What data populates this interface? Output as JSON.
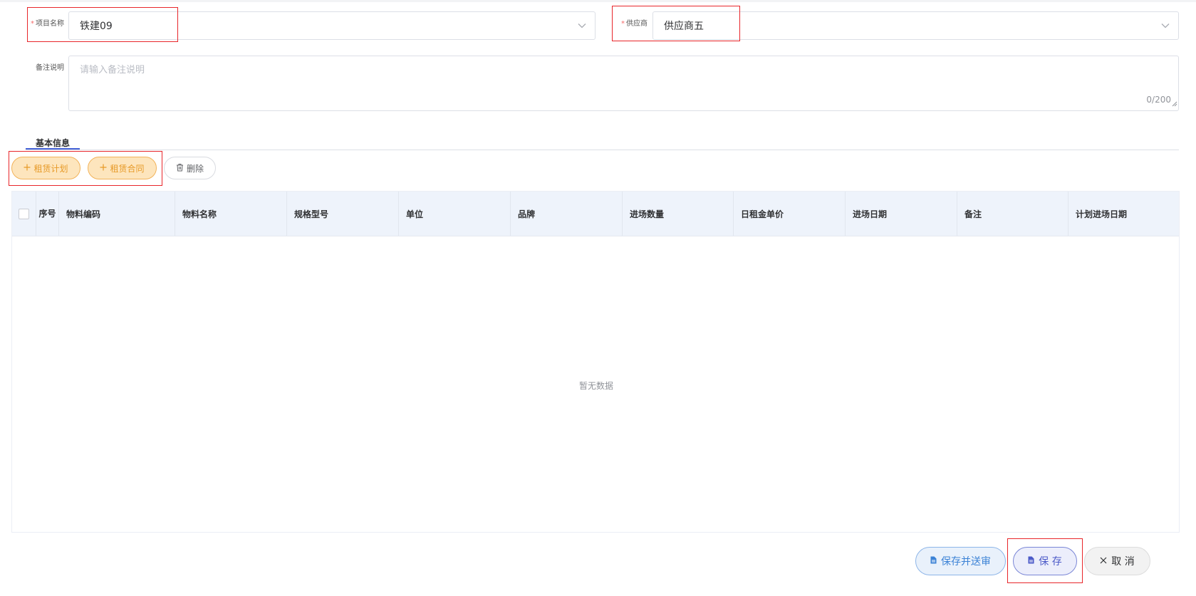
{
  "form": {
    "project": {
      "label": "项目名称",
      "required_mark": "*",
      "value": "铁建09",
      "icon": "chevron-down-icon"
    },
    "supplier": {
      "label": "供应商",
      "required_mark": "*",
      "value": "供应商五",
      "icon": "chevron-down-icon"
    },
    "remark": {
      "label": "备注说明",
      "placeholder": "请输入备注说明",
      "counter": "0/200"
    }
  },
  "tabs": [
    {
      "label": "基本信息",
      "active": true
    }
  ],
  "toolbar": {
    "lease_plan": {
      "icon": "plus-icon",
      "label": "租赁计划"
    },
    "lease_contract": {
      "icon": "plus-icon",
      "label": "租赁合同"
    },
    "delete": {
      "icon": "trash-icon",
      "label": "删除"
    }
  },
  "table": {
    "columns": [
      "序号",
      "物料编码",
      "物料名称",
      "规格型号",
      "单位",
      "品牌",
      "进场数量",
      "日租金单价",
      "进场日期",
      "备注",
      "计划进场日期"
    ],
    "rows": [],
    "empty_text": "暂无数据"
  },
  "footer": {
    "save_submit": {
      "icon": "document-icon",
      "label": "保存并送审"
    },
    "save": {
      "icon": "document-icon",
      "label": "保 存"
    },
    "cancel": {
      "icon": "close-icon",
      "label": "取 消"
    }
  },
  "colors": {
    "primary": "#4461d6",
    "accent_orange": "#e79a27",
    "highlight_red": "#e8262a",
    "header_bg": "#eef3fb"
  }
}
